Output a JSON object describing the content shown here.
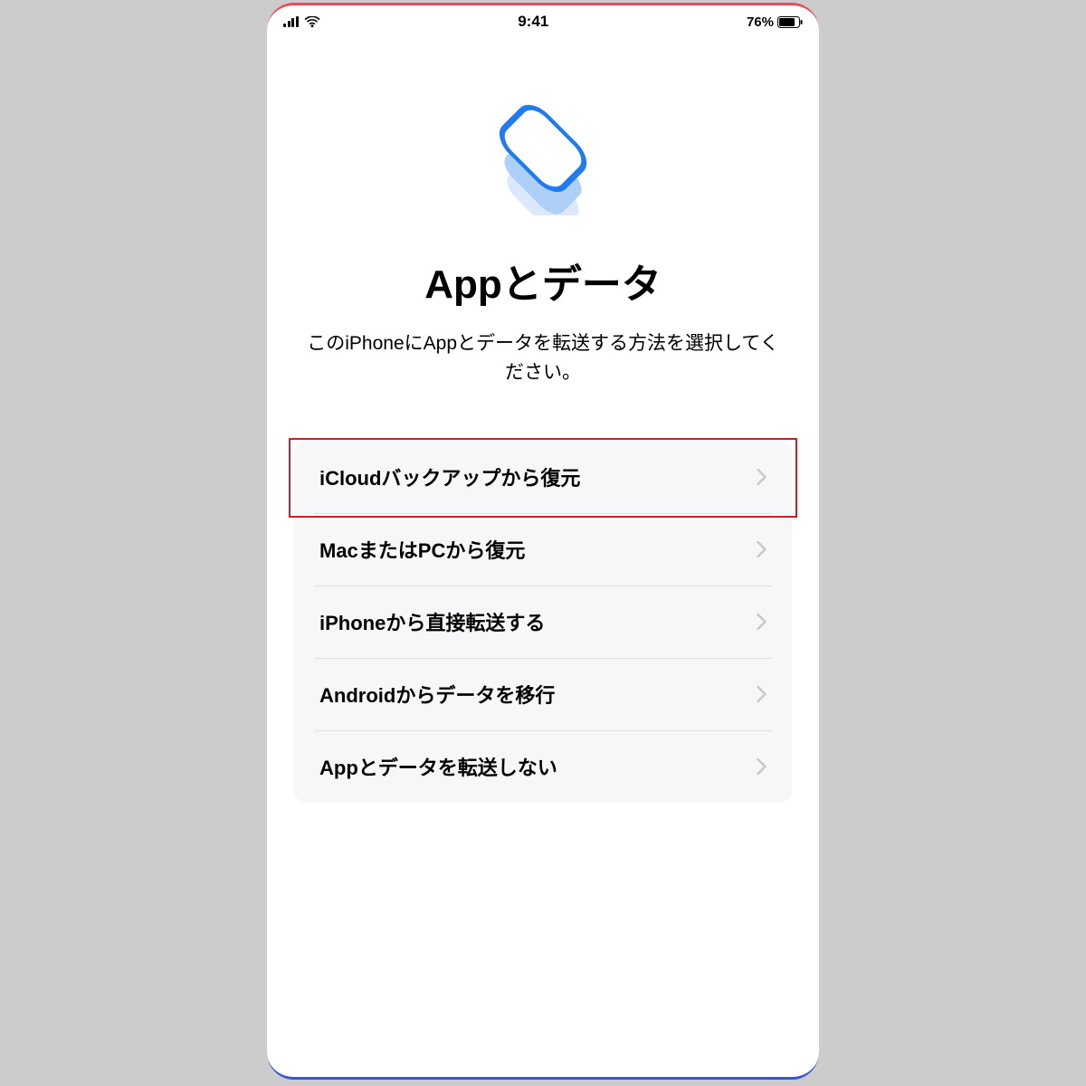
{
  "status": {
    "time": "9:41",
    "battery_text": "76%"
  },
  "main": {
    "title": "Appとデータ",
    "subtitle": "このiPhoneにAppとデータを転送する方法を選択してください。",
    "options": [
      {
        "label": "iCloudバックアップから復元"
      },
      {
        "label": "MacまたはPCから復元"
      },
      {
        "label": "iPhoneから直接転送する"
      },
      {
        "label": "Androidからデータを移行"
      },
      {
        "label": "Appとデータを転送しない"
      }
    ],
    "highlighted_index": 0
  }
}
